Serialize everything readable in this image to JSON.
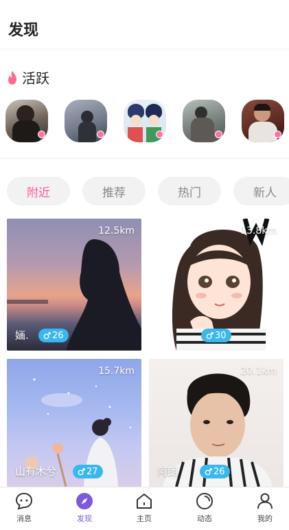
{
  "header": {
    "title": "发现"
  },
  "active_section": {
    "title": "活跃"
  },
  "stories": [
    {
      "name": "user-1",
      "online": true
    },
    {
      "name": "user-2",
      "online": true
    },
    {
      "name": "user-3",
      "online": true
    },
    {
      "name": "user-4",
      "online": true
    },
    {
      "name": "user-5",
      "online": true
    }
  ],
  "tabs": [
    {
      "label": "附近",
      "active": true
    },
    {
      "label": "推荐",
      "active": false
    },
    {
      "label": "热门",
      "active": false
    },
    {
      "label": "新人",
      "active": false
    }
  ],
  "cards": [
    {
      "distance": "12.5km",
      "name": "婳.",
      "gender_icon": "male-icon",
      "age": "26"
    },
    {
      "distance": "13.8km",
      "name": "",
      "gender_icon": "male-icon",
      "age": "30"
    },
    {
      "distance": "15.7km",
      "name": "山有木兮",
      "gender_icon": "male-icon",
      "age": "27"
    },
    {
      "distance": "20.1km",
      "name": "阿朗",
      "gender_icon": "male-icon",
      "age": "26"
    }
  ],
  "nav": [
    {
      "label": "消息",
      "icon": "message-icon",
      "active": false
    },
    {
      "label": "发现",
      "icon": "compass-icon",
      "active": true
    },
    {
      "label": "主页",
      "icon": "home-icon",
      "active": false
    },
    {
      "label": "动态",
      "icon": "moments-icon",
      "active": false
    },
    {
      "label": "我的",
      "icon": "profile-icon",
      "active": false
    }
  ],
  "colors": {
    "accent_pink": "#ff5a8a",
    "online_dot": "#ff6fa3",
    "age_badge": "#3ab7ef",
    "nav_active": "#7b5cd6"
  }
}
